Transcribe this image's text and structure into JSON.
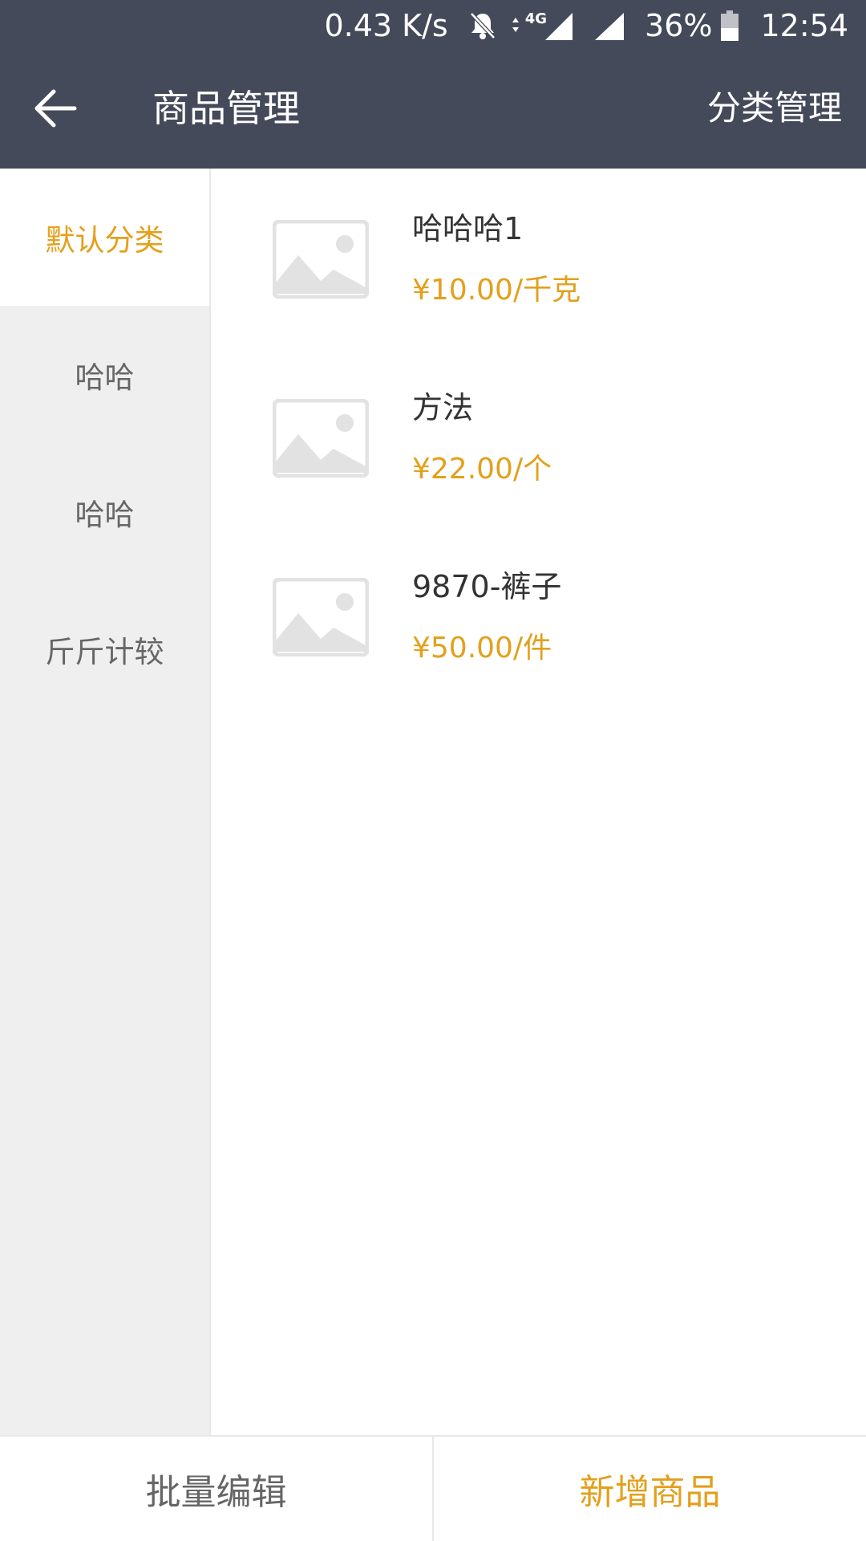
{
  "status_bar": {
    "net_speed": "0.43 K/s",
    "network_type": "4G",
    "battery": "36%",
    "time": "12:54",
    "icons": [
      "bell-off-icon",
      "data-arrows-icon",
      "signal-icon",
      "battery-icon"
    ]
  },
  "header": {
    "back_icon": "arrow-left-icon",
    "title": "商品管理",
    "action_label": "分类管理"
  },
  "sidebar": {
    "items": [
      {
        "label": "默认分类",
        "active": true
      },
      {
        "label": "哈哈",
        "active": false
      },
      {
        "label": "哈哈",
        "active": false
      },
      {
        "label": "斤斤计较",
        "active": false
      }
    ]
  },
  "products": [
    {
      "name": "哈哈哈1",
      "price": "¥10.00/千克",
      "image_icon": "image-placeholder-icon"
    },
    {
      "name": "方法",
      "price": "¥22.00/个",
      "image_icon": "image-placeholder-icon"
    },
    {
      "name": "9870-裤子",
      "price": "¥50.00/件",
      "image_icon": "image-placeholder-icon"
    }
  ],
  "footer": {
    "batch_edit_label": "批量编辑",
    "add_product_label": "新增商品"
  },
  "colors": {
    "header_bg": "#454a5a",
    "accent": "#e3a01c",
    "sidebar_bg": "#efefef",
    "placeholder_gray": "#e2e2e2"
  }
}
